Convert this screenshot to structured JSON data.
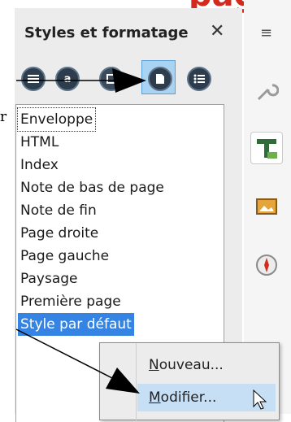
{
  "heading_fragment": "page",
  "left_fragment": "r",
  "panel": {
    "title": "Styles et formatage",
    "close_glyph": "✕"
  },
  "toolbar": {
    "icons": [
      {
        "name": "paragraph-styles-icon",
        "glyph": "≡"
      },
      {
        "name": "character-styles-icon",
        "glyph": "a"
      },
      {
        "name": "frame-styles-icon",
        "glyph": "◘"
      },
      {
        "name": "page-styles-icon",
        "glyph": "▯",
        "active": true
      },
      {
        "name": "list-styles-icon",
        "glyph": "☰"
      }
    ]
  },
  "styles_list": [
    "Enveloppe",
    "HTML",
    "Index",
    "Note de bas de page",
    "Note de fin",
    "Page droite",
    "Page gauche",
    "Paysage",
    "Première page",
    "Style par défaut"
  ],
  "selected_style": "Style par défaut",
  "context_menu": {
    "items": [
      {
        "mnemonic": "N",
        "rest": "ouveau..."
      },
      {
        "mnemonic": "M",
        "rest": "odifier..."
      }
    ]
  },
  "sidebar": {
    "menu_glyph": "≡",
    "icons": [
      "properties-wrench-icon",
      "styles-T-icon",
      "gallery-icon",
      "navigator-compass-icon"
    ]
  },
  "colors": {
    "accent_red": "#d42a1e",
    "selection_blue": "#3584e4",
    "active_tool_blue": "#a9d3f2"
  }
}
